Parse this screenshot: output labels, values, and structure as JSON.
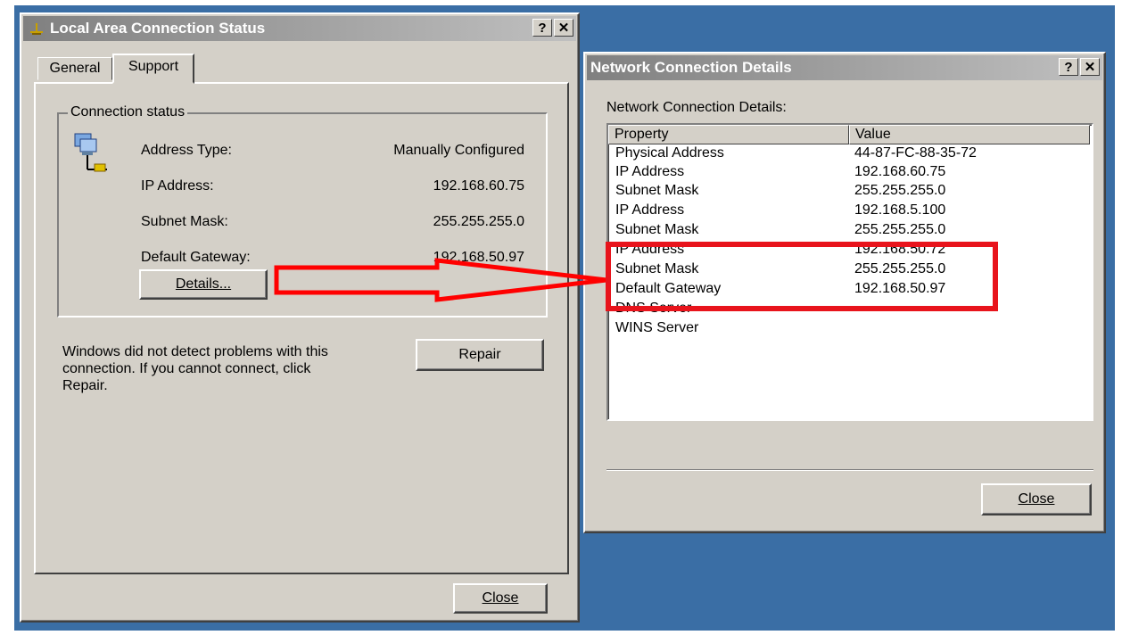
{
  "left_window": {
    "title": "Local Area Connection Status",
    "title_buttons": {
      "help": "?",
      "close": "✕"
    },
    "tabs": [
      {
        "label": "General"
      },
      {
        "label": "Support"
      }
    ],
    "group_label": "Connection status",
    "fields": [
      {
        "label": "Address Type:",
        "value": "Manually Configured"
      },
      {
        "label": "IP Address:",
        "value": "192.168.60.75"
      },
      {
        "label": "Subnet Mask:",
        "value": "255.255.255.0"
      },
      {
        "label": "Default Gateway:",
        "value": "192.168.50.97"
      }
    ],
    "details_button": "Details...",
    "message": [
      "Windows did not detect problems with this",
      "connection. If you cannot connect, click",
      "Repair."
    ],
    "repair_button": "Repair",
    "close_button": "Close"
  },
  "right_window": {
    "title": "Network Connection Details",
    "title_buttons": {
      "help": "?",
      "close": "✕"
    },
    "label": "Network Connection Details:",
    "columns": [
      "Property",
      "Value"
    ],
    "rows": [
      {
        "property": "Physical Address",
        "value": "44-87-FC-88-35-72"
      },
      {
        "property": "IP Address",
        "value": "192.168.60.75"
      },
      {
        "property": "Subnet Mask",
        "value": "255.255.255.0"
      },
      {
        "property": "IP Address",
        "value": "192.168.5.100"
      },
      {
        "property": "Subnet Mask",
        "value": "255.255.255.0"
      },
      {
        "property": "IP Address",
        "value": "192.168.50.72"
      },
      {
        "property": "Subnet Mask",
        "value": "255.255.255.0"
      },
      {
        "property": "Default Gateway",
        "value": "192.168.50.97"
      },
      {
        "property": "DNS Server",
        "value": ""
      },
      {
        "property": "WINS Server",
        "value": ""
      }
    ],
    "close_button": "Close"
  },
  "annotation": {
    "arrow_color": "#ff0000",
    "highlight_color": "#e8141c"
  },
  "colors": {
    "desktop": "#3a6ea5",
    "window_face": "#d4d0c8"
  }
}
